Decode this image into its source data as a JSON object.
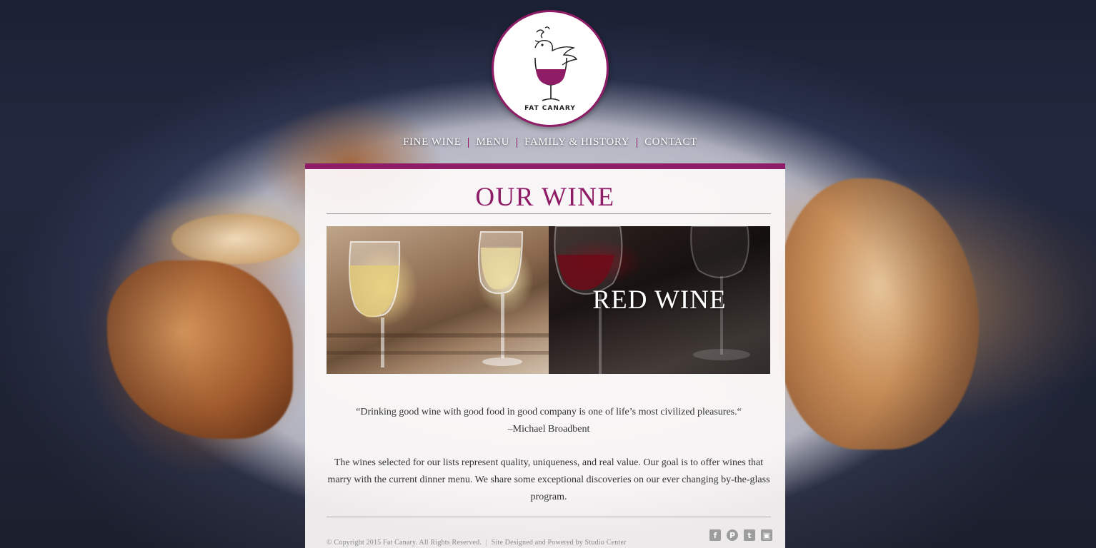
{
  "brand": {
    "logo_text": "FAT CANARY",
    "accent_color": "#8e1c66"
  },
  "nav": {
    "items": [
      {
        "label": "FINE WINE"
      },
      {
        "label": "MENU"
      },
      {
        "label": "FAMILY & HISTORY"
      },
      {
        "label": "CONTACT"
      }
    ]
  },
  "main": {
    "title": "OUR WINE",
    "tiles": [
      {
        "label": ""
      },
      {
        "label": "RED WINE"
      }
    ],
    "quote_text": "“Drinking good wine with good food in good company is one of life’s most civilized pleasures.“",
    "quote_author": "–Michael Broadbent",
    "body_text": "The wines selected for our lists represent quality, uniqueness, and real value. Our goal is to offer wines that marry with the current dinner menu.  We share some exceptional discoveries on our ever changing by-the-glass program."
  },
  "footer": {
    "copyright": "© Copyright 2015 Fat Canary. All Rights Reserved.",
    "separator": "|",
    "credit": "Site Designed and Powered by Studio Center",
    "social": [
      {
        "icon": "facebook-icon",
        "glyph": "f"
      },
      {
        "icon": "pinterest-icon",
        "glyph": "P"
      },
      {
        "icon": "twitter-icon",
        "glyph": "t"
      },
      {
        "icon": "instagram-icon",
        "glyph": "▣"
      }
    ]
  }
}
